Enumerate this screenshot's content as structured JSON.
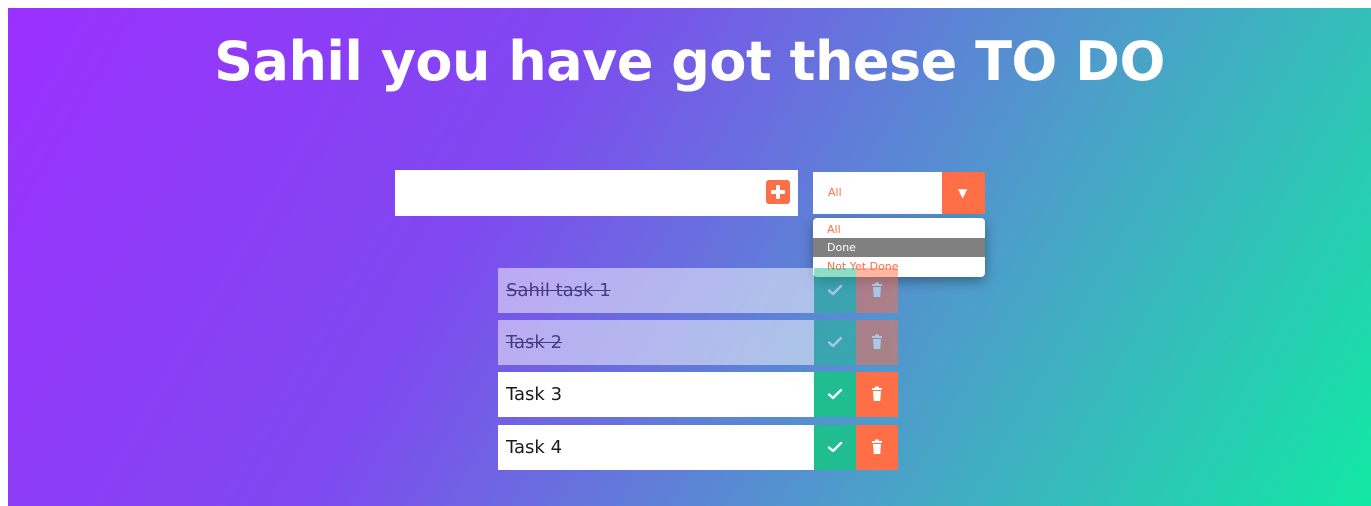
{
  "header": {
    "title": "Sahil you have got these TO DO"
  },
  "form": {
    "input_value": "",
    "filter": {
      "selected": "All",
      "arrow_glyph": "▼",
      "options": [
        {
          "label": "All"
        },
        {
          "label": "Done"
        },
        {
          "label": "Not Yet Done"
        }
      ],
      "highlighted_option": "Done"
    }
  },
  "todos": [
    {
      "text": "Sahil task 1",
      "completed": true
    },
    {
      "text": "Task 2",
      "completed": true
    },
    {
      "text": "Task 3",
      "completed": false
    },
    {
      "text": "Task 4",
      "completed": false
    }
  ],
  "icons": {
    "add": "plus-square-icon",
    "complete": "check-icon",
    "delete": "trash-icon",
    "dropdown": "caret-down-icon"
  },
  "colors": {
    "gradient_start": "#9b30ff",
    "gradient_end": "#12e8a4",
    "accent": "#ff6f47",
    "check": "#1fbd8f",
    "option_highlight": "#808080"
  }
}
